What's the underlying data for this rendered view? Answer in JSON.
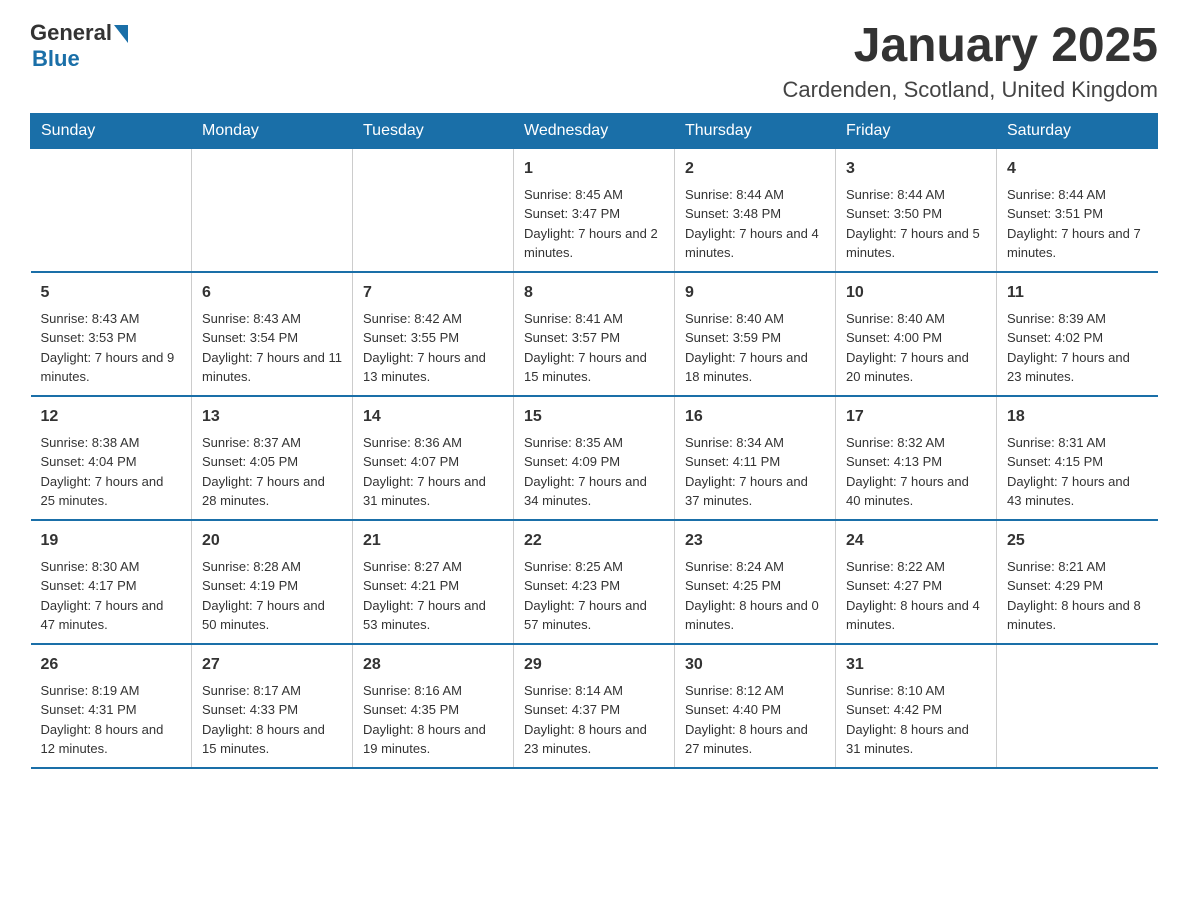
{
  "logo": {
    "text_general": "General",
    "text_blue": "Blue"
  },
  "title": "January 2025",
  "subtitle": "Cardenden, Scotland, United Kingdom",
  "days_of_week": [
    "Sunday",
    "Monday",
    "Tuesday",
    "Wednesday",
    "Thursday",
    "Friday",
    "Saturday"
  ],
  "weeks": [
    [
      {
        "day": "",
        "info": ""
      },
      {
        "day": "",
        "info": ""
      },
      {
        "day": "",
        "info": ""
      },
      {
        "day": "1",
        "info": "Sunrise: 8:45 AM\nSunset: 3:47 PM\nDaylight: 7 hours and 2 minutes."
      },
      {
        "day": "2",
        "info": "Sunrise: 8:44 AM\nSunset: 3:48 PM\nDaylight: 7 hours and 4 minutes."
      },
      {
        "day": "3",
        "info": "Sunrise: 8:44 AM\nSunset: 3:50 PM\nDaylight: 7 hours and 5 minutes."
      },
      {
        "day": "4",
        "info": "Sunrise: 8:44 AM\nSunset: 3:51 PM\nDaylight: 7 hours and 7 minutes."
      }
    ],
    [
      {
        "day": "5",
        "info": "Sunrise: 8:43 AM\nSunset: 3:53 PM\nDaylight: 7 hours and 9 minutes."
      },
      {
        "day": "6",
        "info": "Sunrise: 8:43 AM\nSunset: 3:54 PM\nDaylight: 7 hours and 11 minutes."
      },
      {
        "day": "7",
        "info": "Sunrise: 8:42 AM\nSunset: 3:55 PM\nDaylight: 7 hours and 13 minutes."
      },
      {
        "day": "8",
        "info": "Sunrise: 8:41 AM\nSunset: 3:57 PM\nDaylight: 7 hours and 15 minutes."
      },
      {
        "day": "9",
        "info": "Sunrise: 8:40 AM\nSunset: 3:59 PM\nDaylight: 7 hours and 18 minutes."
      },
      {
        "day": "10",
        "info": "Sunrise: 8:40 AM\nSunset: 4:00 PM\nDaylight: 7 hours and 20 minutes."
      },
      {
        "day": "11",
        "info": "Sunrise: 8:39 AM\nSunset: 4:02 PM\nDaylight: 7 hours and 23 minutes."
      }
    ],
    [
      {
        "day": "12",
        "info": "Sunrise: 8:38 AM\nSunset: 4:04 PM\nDaylight: 7 hours and 25 minutes."
      },
      {
        "day": "13",
        "info": "Sunrise: 8:37 AM\nSunset: 4:05 PM\nDaylight: 7 hours and 28 minutes."
      },
      {
        "day": "14",
        "info": "Sunrise: 8:36 AM\nSunset: 4:07 PM\nDaylight: 7 hours and 31 minutes."
      },
      {
        "day": "15",
        "info": "Sunrise: 8:35 AM\nSunset: 4:09 PM\nDaylight: 7 hours and 34 minutes."
      },
      {
        "day": "16",
        "info": "Sunrise: 8:34 AM\nSunset: 4:11 PM\nDaylight: 7 hours and 37 minutes."
      },
      {
        "day": "17",
        "info": "Sunrise: 8:32 AM\nSunset: 4:13 PM\nDaylight: 7 hours and 40 minutes."
      },
      {
        "day": "18",
        "info": "Sunrise: 8:31 AM\nSunset: 4:15 PM\nDaylight: 7 hours and 43 minutes."
      }
    ],
    [
      {
        "day": "19",
        "info": "Sunrise: 8:30 AM\nSunset: 4:17 PM\nDaylight: 7 hours and 47 minutes."
      },
      {
        "day": "20",
        "info": "Sunrise: 8:28 AM\nSunset: 4:19 PM\nDaylight: 7 hours and 50 minutes."
      },
      {
        "day": "21",
        "info": "Sunrise: 8:27 AM\nSunset: 4:21 PM\nDaylight: 7 hours and 53 minutes."
      },
      {
        "day": "22",
        "info": "Sunrise: 8:25 AM\nSunset: 4:23 PM\nDaylight: 7 hours and 57 minutes."
      },
      {
        "day": "23",
        "info": "Sunrise: 8:24 AM\nSunset: 4:25 PM\nDaylight: 8 hours and 0 minutes."
      },
      {
        "day": "24",
        "info": "Sunrise: 8:22 AM\nSunset: 4:27 PM\nDaylight: 8 hours and 4 minutes."
      },
      {
        "day": "25",
        "info": "Sunrise: 8:21 AM\nSunset: 4:29 PM\nDaylight: 8 hours and 8 minutes."
      }
    ],
    [
      {
        "day": "26",
        "info": "Sunrise: 8:19 AM\nSunset: 4:31 PM\nDaylight: 8 hours and 12 minutes."
      },
      {
        "day": "27",
        "info": "Sunrise: 8:17 AM\nSunset: 4:33 PM\nDaylight: 8 hours and 15 minutes."
      },
      {
        "day": "28",
        "info": "Sunrise: 8:16 AM\nSunset: 4:35 PM\nDaylight: 8 hours and 19 minutes."
      },
      {
        "day": "29",
        "info": "Sunrise: 8:14 AM\nSunset: 4:37 PM\nDaylight: 8 hours and 23 minutes."
      },
      {
        "day": "30",
        "info": "Sunrise: 8:12 AM\nSunset: 4:40 PM\nDaylight: 8 hours and 27 minutes."
      },
      {
        "day": "31",
        "info": "Sunrise: 8:10 AM\nSunset: 4:42 PM\nDaylight: 8 hours and 31 minutes."
      },
      {
        "day": "",
        "info": ""
      }
    ]
  ]
}
